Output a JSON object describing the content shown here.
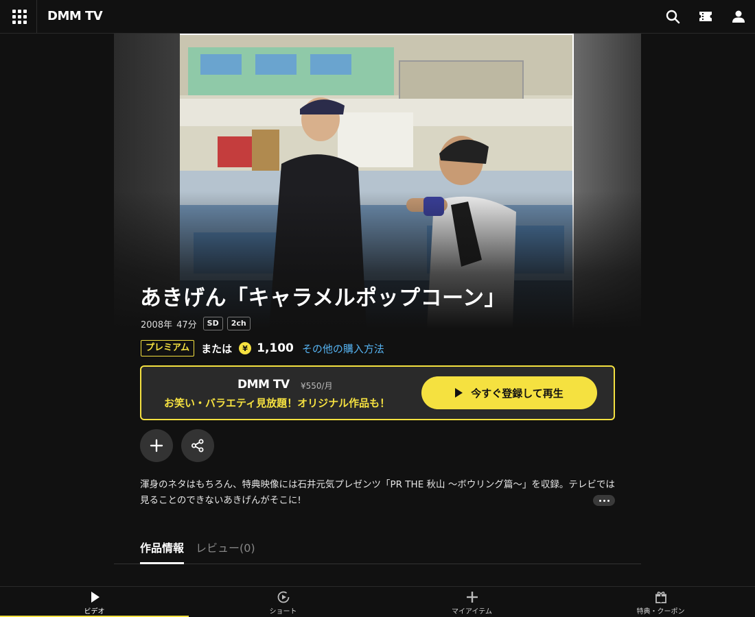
{
  "header": {
    "logo": "DMM TV",
    "icons": [
      "menu-grid-icon",
      "search-icon",
      "ticket-icon",
      "user-icon"
    ]
  },
  "video": {
    "title": "あきげん「キャラメルポップコーン」",
    "year": "2008年",
    "duration": "47分",
    "badges": [
      "SD",
      "2ch"
    ]
  },
  "pricing": {
    "premium_label": "プレミアム",
    "or_label": "または",
    "coin_symbol": "¥",
    "price": "1,100",
    "other_purchase_link": "その他の購入方法"
  },
  "promo": {
    "logo": "DMM TV",
    "monthly_price": "¥550/月",
    "tagline": "お笑い・バラエティ見放題！オリジナル作品も！",
    "cta_label": "今すぐ登録して再生"
  },
  "description": {
    "text": "渾身のネタはもちろん、特典映像には石井元気プレゼンツ「PR THE 秋山 ～ボウリング篇～」を収録。テレビでは見ることのできないあきげんがそこに!"
  },
  "tabs": [
    {
      "label": "作品情報",
      "active": true
    },
    {
      "label": "レビュー(0)",
      "active": false
    }
  ],
  "bottom_nav": [
    {
      "label": "ビデオ",
      "icon": "play-icon",
      "active": true
    },
    {
      "label": "ショート",
      "icon": "short-icon",
      "active": false
    },
    {
      "label": "マイアイテム",
      "icon": "plus-icon",
      "active": false
    },
    {
      "label": "特典・クーポン",
      "icon": "gift-icon",
      "active": false
    }
  ],
  "colors": {
    "accent": "#f5e140",
    "link": "#56b4f3",
    "background": "#111111"
  }
}
